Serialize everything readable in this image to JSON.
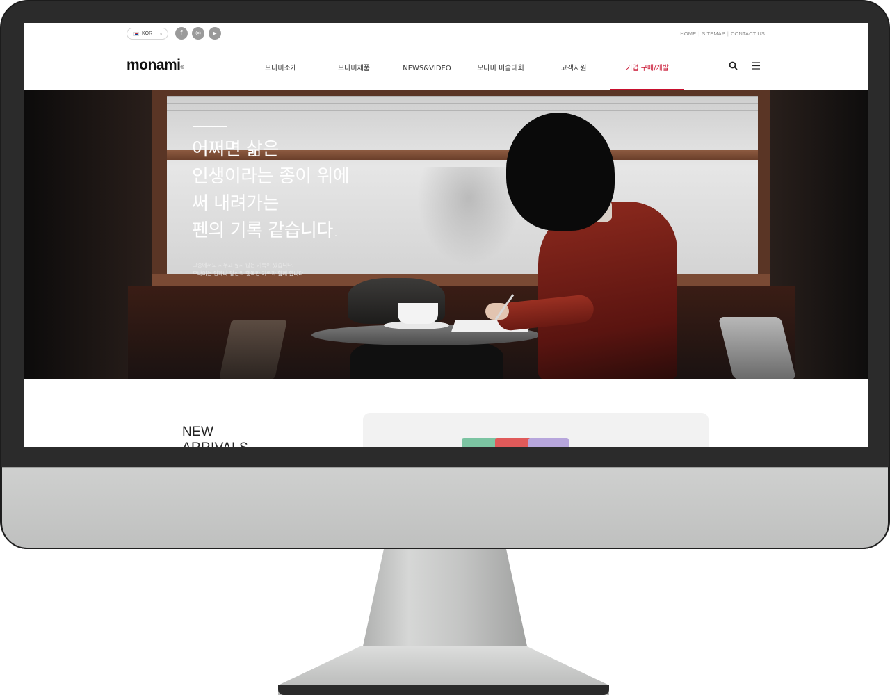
{
  "utility_bar": {
    "language": "KOR",
    "social": [
      {
        "name": "facebook",
        "glyph": "f"
      },
      {
        "name": "instagram",
        "glyph": "◎"
      },
      {
        "name": "youtube",
        "glyph": "▶"
      }
    ],
    "links": [
      "HOME",
      "SITEMAP",
      "CONTACT US"
    ]
  },
  "header": {
    "logo": "monami",
    "logo_mark": "®",
    "nav": [
      "모나미소개",
      "모나미제품",
      "NEWS&VIDEO",
      "모나미 미술대회",
      "고객지원",
      "기업 구매/개발"
    ],
    "active_index": 5,
    "accent_color": "#c8102e"
  },
  "hero": {
    "title": "어쩌면 삶은\n인생이라는 종이 위에\n써 내려가는\n펜의 기록 같습니다.",
    "subtitle": "그중에서도 지우고 싶지 않은 기록이 있습니다.\n모나미는 언제나 당신의 행복한 기록과 함께 합니다."
  },
  "new_arrivals": {
    "title": "NEW\nARRIVALS"
  }
}
